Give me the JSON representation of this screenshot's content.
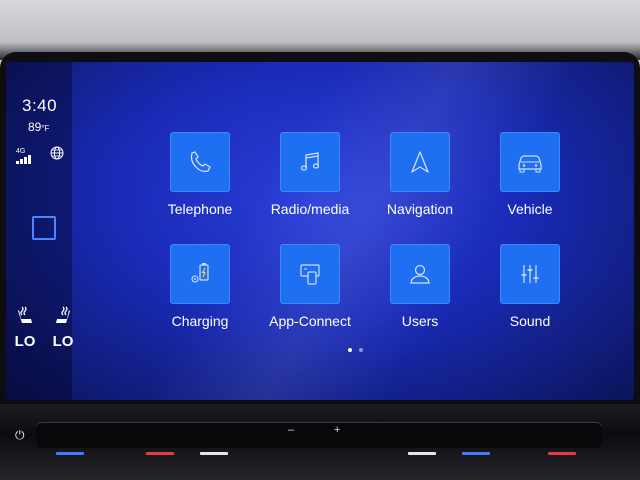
{
  "status": {
    "time": "3:40",
    "temperature": "89",
    "temperature_unit": "°F",
    "network": "4G"
  },
  "seats": [
    {
      "label": "LO"
    },
    {
      "label": "LO"
    }
  ],
  "apps": [
    {
      "label": "Telephone",
      "icon": "phone-icon"
    },
    {
      "label": "Radio/media",
      "icon": "music-note-icon"
    },
    {
      "label": "Navigation",
      "icon": "navigation-arrow-icon"
    },
    {
      "label": "Vehicle",
      "icon": "car-icon"
    },
    {
      "label": "Charging",
      "icon": "charging-icon"
    },
    {
      "label": "App-Connect",
      "icon": "app-connect-icon"
    },
    {
      "label": "Users",
      "icon": "user-icon"
    },
    {
      "label": "Sound",
      "icon": "equalizer-icon"
    }
  ],
  "pager": {
    "current_page": 1,
    "total_pages": 2
  },
  "controls": {
    "volume_minus": "–",
    "volume_plus": "+"
  },
  "colors": {
    "tile": "#1f6ff2",
    "screen": "#1a2bb8",
    "accent_square": "#4f84ff",
    "indicator_red": "#e8384a",
    "indicator_blue": "#3d7bff",
    "indicator_white": "#e6e6ea"
  }
}
